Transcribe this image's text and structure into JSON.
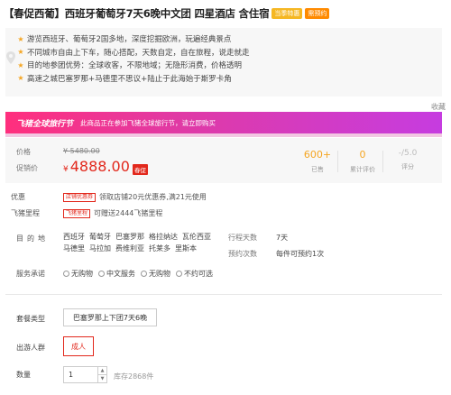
{
  "title": {
    "text": "【春促西葡】西班牙葡萄牙7天6晚中文团 四星酒店 含住宿",
    "badges": [
      "当季特惠",
      "需预约"
    ]
  },
  "features": [
    "游览西班牙、葡萄牙2国多地，深度挖掘欧洲，玩遍经典景点",
    "不同城市自由上下车，随心搭配，天数自定，自在旅程，说走就走",
    "目的地参团优势：全球收客，不限地域；无隐形消费，价格透明",
    "高速之城巴塞罗那+马德里不思议+陆止于此海始于斯罗卡角"
  ],
  "favorite_label": "收藏",
  "promo": {
    "brand": "飞猪全球旅行节",
    "message": "此商品正在参加飞猪全球旅行节，请立即购买"
  },
  "price": {
    "label": "价格",
    "original": "¥ 5480.00",
    "sale_label": "促销价",
    "currency": "¥",
    "sale": "4888.00",
    "badge": "春促",
    "stats": [
      {
        "value": "600+",
        "label": "已售"
      },
      {
        "value": "0",
        "label": "累计评价"
      },
      {
        "value": "-/5.0",
        "label": "评分"
      }
    ]
  },
  "offers": {
    "coupon_label": "优惠",
    "coupon_tag": "店铺优惠券",
    "coupon_text": "领取店铺20元优惠券,满21元使用",
    "miles_label": "飞猪里程",
    "miles_tag": "飞猪里程",
    "miles_text": "可赠送2444飞猪里程"
  },
  "destination": {
    "label": "目的地",
    "places": [
      "西班牙",
      "葡萄牙",
      "巴塞罗那",
      "格拉纳达",
      "瓦伦西亚",
      "马德里",
      "马拉加",
      "费维利亚",
      "托莱多",
      "里斯本"
    ],
    "days_label": "行程天数",
    "days": "7天",
    "schedule_label": "预约次数",
    "schedule": "每件可预约1次"
  },
  "services": {
    "label": "服务承诺",
    "items": [
      "无购物",
      "中文服务",
      "无购物",
      "不约可选"
    ]
  },
  "form": {
    "package_label": "套餐类型",
    "package_value": "巴塞罗那上下团7天6晚",
    "traveler_label": "出游人群",
    "traveler_value": "成人",
    "quantity_label": "数量",
    "quantity_value": "1",
    "stock": "库存2868件"
  },
  "colors": {
    "accent": "#e2281c",
    "star": "#f5a623",
    "promo_start": "#ff2f7d",
    "promo_end": "#c63ce0"
  }
}
